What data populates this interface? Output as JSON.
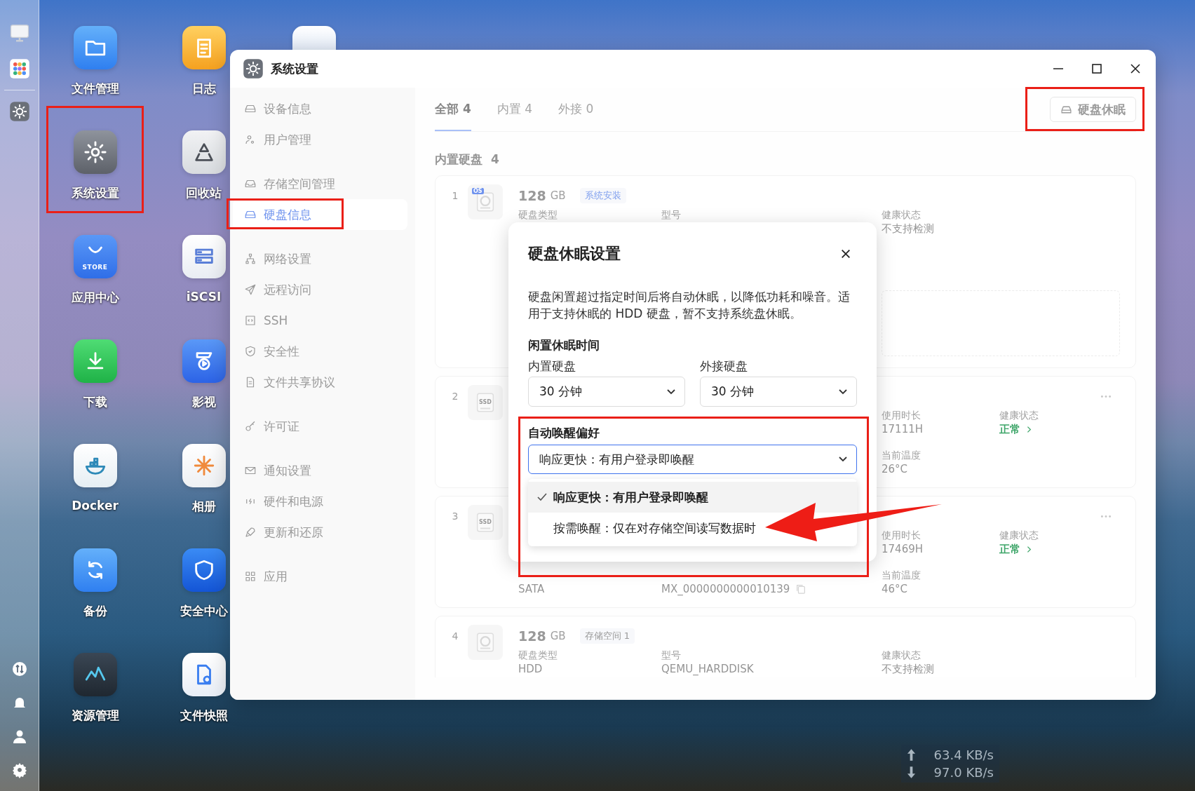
{
  "desktop_apps": [
    {
      "label": "文件管理"
    },
    {
      "label": "系统设置"
    },
    {
      "label": "应用中心",
      "icon_text": "STORE"
    },
    {
      "label": "下载"
    },
    {
      "label": "Docker"
    },
    {
      "label": "备份"
    },
    {
      "label": "资源管理"
    },
    {
      "label": "日志"
    },
    {
      "label": "回收站"
    },
    {
      "label": "iSCSI"
    },
    {
      "label": "影视"
    },
    {
      "label": "相册"
    },
    {
      "label": "安全中心"
    },
    {
      "label": "文件快照"
    }
  ],
  "window": {
    "title": "系统设置"
  },
  "sidebar": {
    "groups": [
      {
        "items": [
          {
            "label": "设备信息",
            "selected": false
          },
          {
            "label": "用户管理",
            "selected": false
          }
        ]
      },
      {
        "items": [
          {
            "label": "存储空间管理",
            "selected": false
          },
          {
            "label": "硬盘信息",
            "selected": true
          }
        ]
      },
      {
        "items": [
          {
            "label": "网络设置",
            "selected": false
          },
          {
            "label": "远程访问",
            "selected": false
          },
          {
            "label": "SSH",
            "selected": false
          },
          {
            "label": "安全性",
            "selected": false
          },
          {
            "label": "文件共享协议",
            "selected": false
          }
        ]
      },
      {
        "items": [
          {
            "label": "许可证",
            "selected": false
          }
        ]
      },
      {
        "items": [
          {
            "label": "通知设置",
            "selected": false
          },
          {
            "label": "硬件和电源",
            "selected": false
          },
          {
            "label": "更新和还原",
            "selected": false
          }
        ]
      },
      {
        "items": [
          {
            "label": "应用",
            "selected": false
          }
        ]
      }
    ]
  },
  "tabs": [
    {
      "label": "全部 4",
      "selected": true
    },
    {
      "label": "内置 4",
      "selected": false
    },
    {
      "label": "外接 0",
      "selected": false
    }
  ],
  "sleep_button": {
    "label": "硬盘休眠"
  },
  "section": {
    "title": "内置硬盘",
    "count": "4"
  },
  "disks": [
    {
      "kind": "os",
      "number": "1",
      "icon_label": "OS",
      "size": "128",
      "unit": "GB",
      "tag": {
        "text": "系统安装",
        "color": "#7f9fee"
      },
      "has_menu": false,
      "fields": [
        {
          "kind": "type",
          "label": "硬盘类型"
        },
        {
          "kind": "model",
          "label": "型号"
        },
        {
          "kind": "health",
          "label": "健康状态",
          "value": "不支持检测",
          "healthy": false
        }
      ]
    },
    {
      "kind": "ssd",
      "number": "2",
      "icon_label": "SSD",
      "has_menu": true,
      "fields": [
        {
          "kind": "hours",
          "label": "使用时长",
          "value": "17111H"
        },
        {
          "kind": "health",
          "label": "健康状态",
          "value": "正常",
          "healthy": true
        },
        {
          "kind": "temperature",
          "label": "当前温度",
          "value": "26°C"
        }
      ]
    },
    {
      "kind": "ssd",
      "number": "3",
      "icon_label": "SSD",
      "has_menu": true,
      "fields": [
        {
          "kind": "hours",
          "label": "使用时长",
          "value": "17469H"
        },
        {
          "kind": "health",
          "label": "健康状态",
          "value": "正常",
          "healthy": true
        },
        {
          "kind": "interface",
          "value": "SATA"
        },
        {
          "kind": "serial",
          "value": "MX_0000000000010139"
        },
        {
          "kind": "temperature",
          "label": "当前温度",
          "value": "46°C"
        }
      ]
    },
    {
      "kind": "hdd",
      "number": "4",
      "size": "128",
      "unit": "GB",
      "tag": {
        "text": "存储空间 1",
        "color": "#9a9a9a"
      },
      "has_menu": false,
      "fields": [
        {
          "kind": "type",
          "label": "硬盘类型",
          "value": "HDD"
        },
        {
          "kind": "model",
          "label": "型号",
          "value": "QEMU_HARDDISK"
        },
        {
          "kind": "health",
          "label": "健康状态",
          "value": "不支持检测",
          "healthy": false
        }
      ]
    }
  ],
  "modal": {
    "title": "硬盘休眠设置",
    "description": "硬盘闲置超过指定时间后将自动休眠，以降低功耗和噪音。适用于支持休眠的 HDD 硬盘，暂不支持系统盘休眠。",
    "idle_heading": "闲置休眠时间",
    "selects": [
      {
        "label": "内置硬盘",
        "value": "30 分钟"
      },
      {
        "label": "外接硬盘",
        "value": "30 分钟"
      }
    ],
    "wake_heading": "自动唤醒偏好",
    "wake_select": {
      "value": "响应更快：有用户登录即唤醒",
      "expanded": true,
      "options": [
        {
          "label": "响应更快：有用户登录即唤醒",
          "selected": true
        },
        {
          "label": "按需唤醒：仅在对存储空间读写数据时",
          "selected": false
        }
      ]
    }
  },
  "network_speed": {
    "upload": "63.4 KB/s",
    "download": "97.0 KB/s"
  }
}
